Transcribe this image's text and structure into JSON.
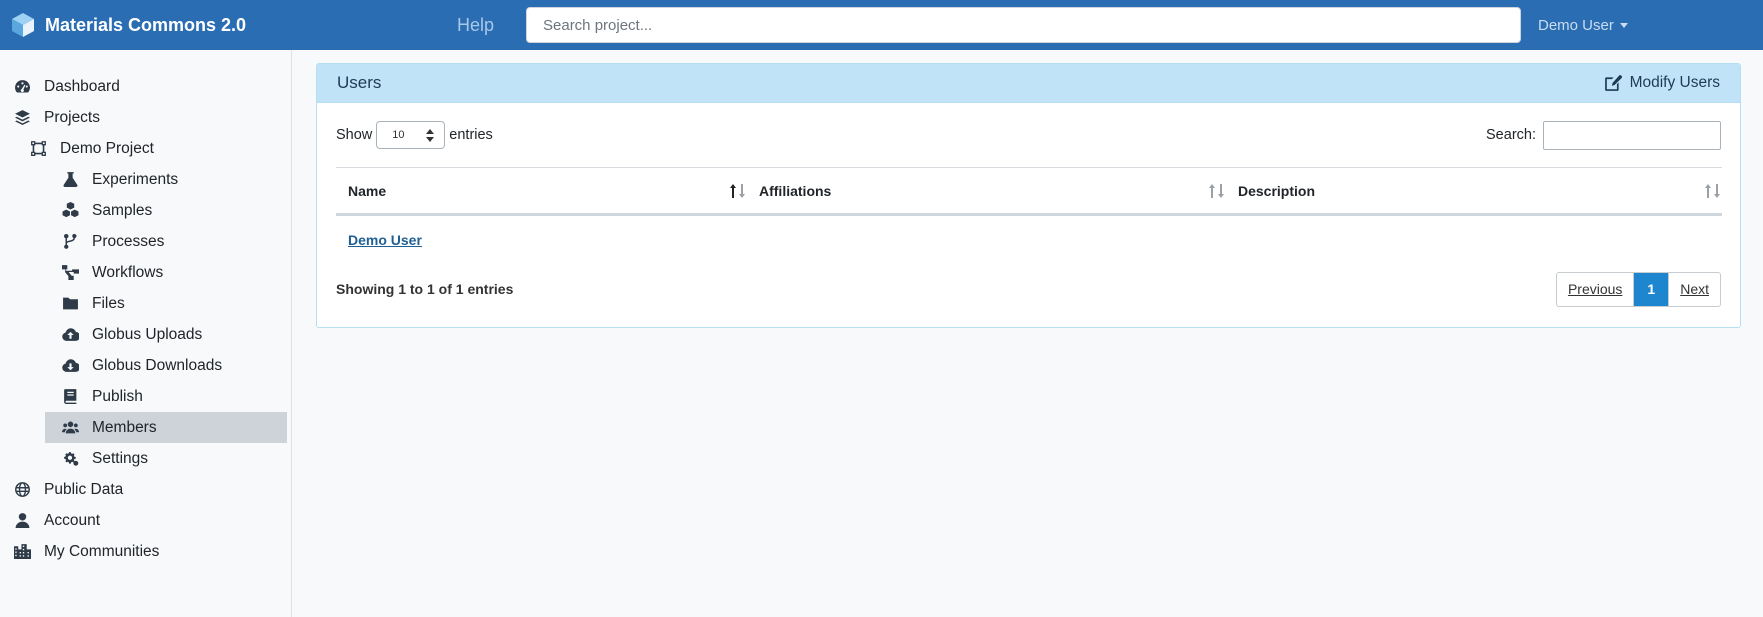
{
  "navbar": {
    "brand": "Materials Commons 2.0",
    "help": "Help",
    "search_placeholder": "Search project...",
    "user": "Demo User"
  },
  "sidebar": {
    "items": [
      {
        "label": "Dashboard",
        "icon": "dashboard-icon",
        "level": 0
      },
      {
        "label": "Projects",
        "icon": "layers-icon",
        "level": 0
      },
      {
        "label": "Demo Project",
        "icon": "project-icon",
        "level": 1
      },
      {
        "label": "Experiments",
        "icon": "flask-icon",
        "level": 2
      },
      {
        "label": "Samples",
        "icon": "cubes-icon",
        "level": 2
      },
      {
        "label": "Processes",
        "icon": "code-branch-icon",
        "level": 2
      },
      {
        "label": "Workflows",
        "icon": "workflow-icon",
        "level": 2
      },
      {
        "label": "Files",
        "icon": "folder-icon",
        "level": 2
      },
      {
        "label": "Globus Uploads",
        "icon": "cloud-upload-icon",
        "level": 2
      },
      {
        "label": "Globus Downloads",
        "icon": "cloud-download-icon",
        "level": 2
      },
      {
        "label": "Publish",
        "icon": "book-icon",
        "level": 2
      },
      {
        "label": "Members",
        "icon": "users-icon",
        "level": 2,
        "active": true
      },
      {
        "label": "Settings",
        "icon": "cogs-icon",
        "level": 2
      },
      {
        "label": "Public Data",
        "icon": "globe-icon",
        "level": 0
      },
      {
        "label": "Account",
        "icon": "user-icon",
        "level": 0
      },
      {
        "label": "My Communities",
        "icon": "city-icon",
        "level": 0
      }
    ]
  },
  "card": {
    "title": "Users",
    "modify_label": "Modify Users",
    "show_label": "Show",
    "entries_value": "10",
    "entries_label": "entries",
    "search_label": "Search:",
    "search_value": "",
    "columns": [
      "Name",
      "Affiliations",
      "Description"
    ],
    "rows": [
      {
        "name": "Demo User",
        "affiliations": "",
        "description": ""
      }
    ],
    "showing": "Showing 1 to 1 of 1 entries",
    "pager": {
      "previous": "Previous",
      "current": "1",
      "next": "Next"
    }
  },
  "colors": {
    "navbar": "#2a6db2",
    "card_header": "#c0e3f7",
    "active_item": "#cdd3d9",
    "pager_current": "#1d86cf"
  }
}
